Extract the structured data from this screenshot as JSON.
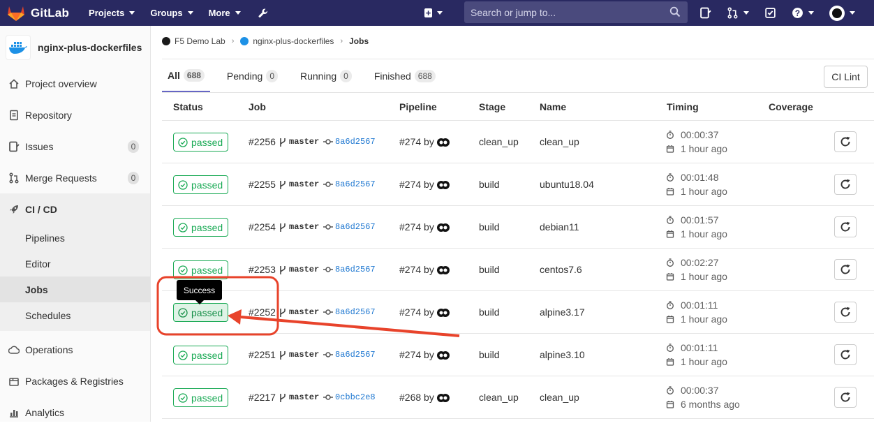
{
  "app": {
    "name": "GitLab"
  },
  "topnav": {
    "items": [
      "Projects",
      "Groups",
      "More"
    ],
    "search_placeholder": "Search or jump to..."
  },
  "sidebar": {
    "project_name": "nginx-plus-dockerfiles",
    "items": [
      {
        "label": "Project overview",
        "icon": "home-icon"
      },
      {
        "label": "Repository",
        "icon": "doc-icon"
      },
      {
        "label": "Issues",
        "icon": "issues-icon",
        "count": "0"
      },
      {
        "label": "Merge Requests",
        "icon": "merge-request-icon",
        "count": "0"
      },
      {
        "label": "CI / CD",
        "icon": "rocket-icon"
      }
    ],
    "cicd_sub": [
      "Pipelines",
      "Editor",
      "Jobs",
      "Schedules"
    ],
    "bottom": [
      {
        "label": "Operations",
        "icon": "cloud-gear-icon"
      },
      {
        "label": "Packages & Registries",
        "icon": "package-icon"
      },
      {
        "label": "Analytics",
        "icon": "chart-icon"
      }
    ]
  },
  "breadcrumb": {
    "group": "F5 Demo Lab",
    "project": "nginx-plus-dockerfiles",
    "current": "Jobs"
  },
  "tabs": [
    {
      "label": "All",
      "count": "688"
    },
    {
      "label": "Pending",
      "count": "0"
    },
    {
      "label": "Running",
      "count": "0"
    },
    {
      "label": "Finished",
      "count": "688"
    }
  ],
  "ci_lint_label": "CI Lint",
  "columns": [
    "Status",
    "Job",
    "Pipeline",
    "Stage",
    "Name",
    "Timing",
    "Coverage"
  ],
  "jobs": [
    {
      "status": "passed",
      "id": "#2256",
      "branch": "master",
      "sha": "8a6d2567",
      "pipeline": "#274 by",
      "stage": "clean_up",
      "name": "clean_up",
      "duration": "00:00:37",
      "ago": "1 hour ago"
    },
    {
      "status": "passed",
      "id": "#2255",
      "branch": "master",
      "sha": "8a6d2567",
      "pipeline": "#274 by",
      "stage": "build",
      "name": "ubuntu18.04",
      "duration": "00:01:48",
      "ago": "1 hour ago"
    },
    {
      "status": "passed",
      "id": "#2254",
      "branch": "master",
      "sha": "8a6d2567",
      "pipeline": "#274 by",
      "stage": "build",
      "name": "debian11",
      "duration": "00:01:57",
      "ago": "1 hour ago"
    },
    {
      "status": "passed",
      "id": "#2253",
      "branch": "master",
      "sha": "8a6d2567",
      "pipeline": "#274 by",
      "stage": "build",
      "name": "centos7.6",
      "duration": "00:02:27",
      "ago": "1 hour ago"
    },
    {
      "status": "passed",
      "id": "#2252",
      "branch": "master",
      "sha": "8a6d2567",
      "pipeline": "#274 by",
      "stage": "build",
      "name": "alpine3.17",
      "duration": "00:01:11",
      "ago": "1 hour ago"
    },
    {
      "status": "passed",
      "id": "#2251",
      "branch": "master",
      "sha": "8a6d2567",
      "pipeline": "#274 by",
      "stage": "build",
      "name": "alpine3.10",
      "duration": "00:01:11",
      "ago": "1 hour ago"
    },
    {
      "status": "passed",
      "id": "#2217",
      "branch": "master",
      "sha": "0cbbc2e8",
      "pipeline": "#268 by",
      "stage": "clean_up",
      "name": "clean_up",
      "duration": "00:00:37",
      "ago": "6 months ago"
    }
  ],
  "tooltip": {
    "text": "Success"
  },
  "colors": {
    "nav_bg": "#292961",
    "success": "#1aaa55",
    "link": "#1f78d1",
    "annotation": "#e8432b"
  }
}
